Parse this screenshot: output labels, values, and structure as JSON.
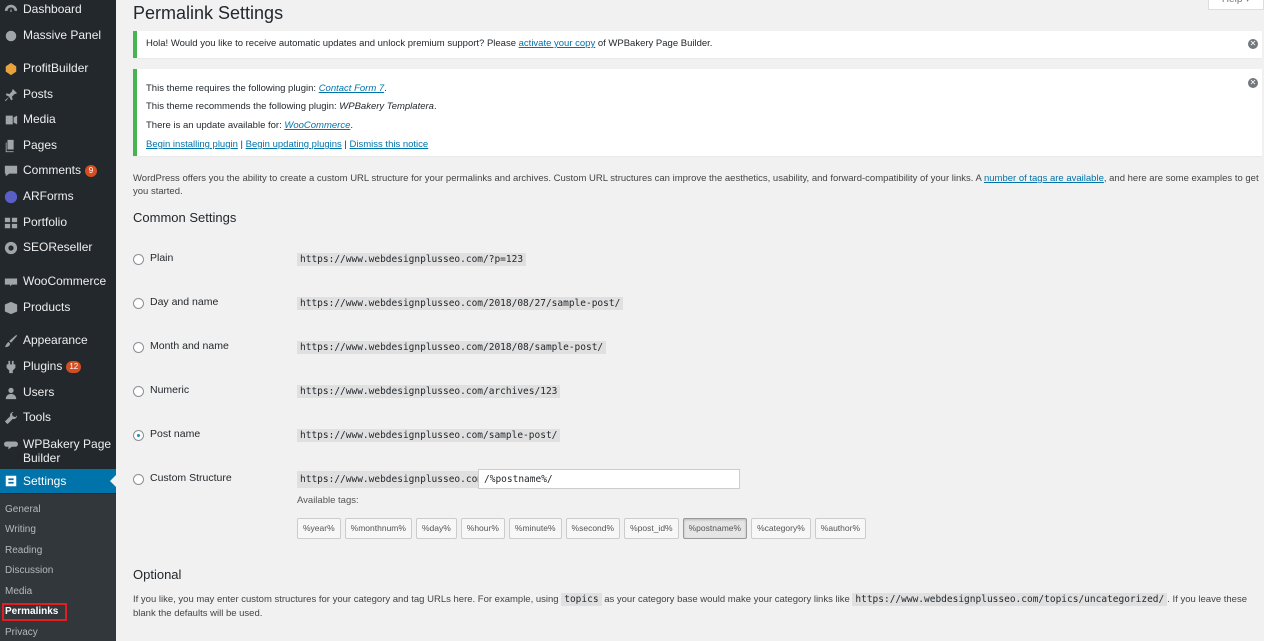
{
  "sidebar": {
    "items": [
      {
        "label": "Dashboard",
        "icon": "dashboard-icon"
      },
      {
        "label": "Massive Panel",
        "icon": "panel-icon"
      },
      {
        "label": "ProfitBuilder",
        "icon": "profitbuilder-icon"
      },
      {
        "label": "Posts",
        "icon": "pin-icon"
      },
      {
        "label": "Media",
        "icon": "media-icon"
      },
      {
        "label": "Pages",
        "icon": "pages-icon"
      },
      {
        "label": "Comments",
        "icon": "comments-icon",
        "badge": "9"
      },
      {
        "label": "ARForms",
        "icon": "arforms-icon"
      },
      {
        "label": "Portfolio",
        "icon": "portfolio-icon"
      },
      {
        "label": "SEOReseller",
        "icon": "seoreseller-icon"
      },
      {
        "label": "WooCommerce",
        "icon": "woocommerce-icon"
      },
      {
        "label": "Products",
        "icon": "products-icon"
      },
      {
        "label": "Appearance",
        "icon": "brush-icon"
      },
      {
        "label": "Plugins",
        "icon": "plugin-icon",
        "badge": "12"
      },
      {
        "label": "Users",
        "icon": "users-icon"
      },
      {
        "label": "Tools",
        "icon": "wrench-icon"
      },
      {
        "label": "WPBakery Page Builder",
        "label_line1": "WPBakery Page",
        "label_line2": "Builder",
        "icon": "wpbakery-icon"
      },
      {
        "label": "Settings",
        "icon": "settings-icon",
        "active": true
      }
    ],
    "submenu": [
      "General",
      "Writing",
      "Reading",
      "Discussion",
      "Media",
      "Permalinks",
      "Privacy"
    ]
  },
  "header": {
    "title": "Permalink Settings",
    "help": "Help ▾"
  },
  "notices": {
    "wpbakery": {
      "before": "Hola! Would you like to receive automatic updates and unlock premium support? Please ",
      "link": "activate your copy",
      "after": " of WPBakery Page Builder."
    },
    "plugins": {
      "line1_before": "This theme requires the following plugin: ",
      "line1_link": "Contact Form 7",
      "line1_after": ".",
      "line2_before": "This theme recommends the following plugin: ",
      "line2_em": "WPBakery Templatera",
      "line2_after": ".",
      "line3_before": "There is an update available for: ",
      "line3_link": "WooCommerce",
      "line3_after": ".",
      "action1": "Begin installing plugin",
      "sep1": " | ",
      "action2": "Begin updating plugins",
      "sep2": " | ",
      "action3": "Dismiss this notice"
    }
  },
  "intro": {
    "before": "WordPress offers you the ability to create a custom URL structure for your permalinks and archives. Custom URL structures can improve the aesthetics, usability, and forward-compatibility of your links. A ",
    "link": "number of tags are available",
    "after": ", and here are some examples to get you started."
  },
  "common": {
    "heading": "Common Settings",
    "options": [
      {
        "label": "Plain",
        "example": "https://www.webdesignplusseo.com/?p=123",
        "checked": false
      },
      {
        "label": "Day and name",
        "example": "https://www.webdesignplusseo.com/2018/08/27/sample-post/",
        "checked": false
      },
      {
        "label": "Month and name",
        "example": "https://www.webdesignplusseo.com/2018/08/sample-post/",
        "checked": false
      },
      {
        "label": "Numeric",
        "example": "https://www.webdesignplusseo.com/archives/123",
        "checked": false
      },
      {
        "label": "Post name",
        "example": "https://www.webdesignplusseo.com/sample-post/",
        "checked": true
      },
      {
        "label": "Custom Structure",
        "example": "https://www.webdesignplusseo.com",
        "checked": false
      }
    ],
    "custom_value": "/%postname%/",
    "available_tags_label": "Available tags:",
    "tags": [
      "%year%",
      "%monthnum%",
      "%day%",
      "%hour%",
      "%minute%",
      "%second%",
      "%post_id%",
      "%postname%",
      "%category%",
      "%author%"
    ],
    "active_tag": "%postname%"
  },
  "optional": {
    "heading": "Optional",
    "text_before": "If you like, you may enter custom structures for your category and tag URLs here. For example, using ",
    "code1": "topics",
    "text_mid": " as your category base would make your category links like ",
    "code2": "https://www.webdesignplusseo.com/topics/uncategorized/",
    "text_after": ". If you leave these blank the defaults will be used."
  },
  "colors": {
    "sidebar": "#23282d",
    "active": "#0073aa",
    "notice_border": "#46b450",
    "highlight": "#e02020"
  }
}
